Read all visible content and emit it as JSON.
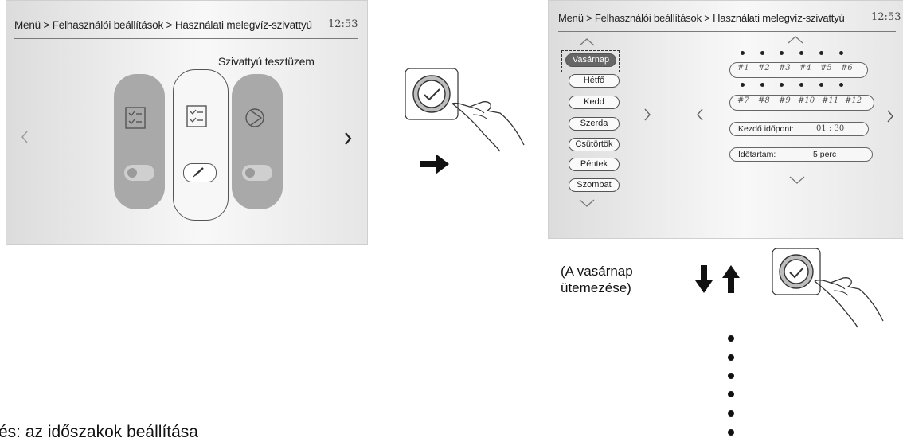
{
  "screen1": {
    "breadcrumb": "Menü > Felhasználói beállítások > Használati melegvíz-szivattyú",
    "time": "12:53",
    "subtitle": "Szivattyú tesztüzem",
    "icons": [
      "left-chevron-icon",
      "checklist-icon",
      "checklist-icon",
      "pump-icon",
      "right-chevron-icon",
      "edit-icon"
    ]
  },
  "screen2": {
    "breadcrumb": "Menü > Felhasználói beállítások > Használati melegvíz-szivattyú",
    "time": "12:53",
    "days": [
      {
        "label": "Vasárnap",
        "active": true
      },
      {
        "label": "Hétfő",
        "active": false
      },
      {
        "label": "Kedd",
        "active": false
      },
      {
        "label": "Szerda",
        "active": false
      },
      {
        "label": "Csütörtök",
        "active": false
      },
      {
        "label": "Péntek",
        "active": false
      },
      {
        "label": "Szombat",
        "active": false
      }
    ],
    "slots_row1": [
      "#1",
      "#2",
      "#3",
      "#4",
      "#5",
      "#6"
    ],
    "slots_row2": [
      "#7",
      "#8",
      "#9",
      "#10",
      "#11",
      "#12"
    ],
    "start_label": "Kezdő időpont:",
    "start_value": "01 : 30",
    "duration_label": "Időtartam:",
    "duration_value": "5 perc"
  },
  "caption": {
    "line1": "(A vasárnap",
    "line2": "ütemezése)"
  },
  "bottom_text": "és: az időszakok beállítása"
}
